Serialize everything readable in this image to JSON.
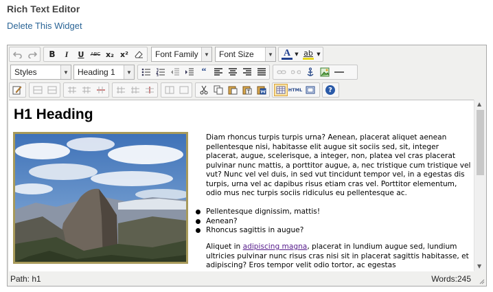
{
  "page": {
    "title": "Rich Text Editor",
    "delete_link": "Delete This Widget"
  },
  "toolbar": {
    "bold": "B",
    "italic": "I",
    "underline": "U",
    "strike": "ABC",
    "subscript": "x₂",
    "superscript": "x²",
    "font_family": "Font Family",
    "font_size": "Font Size",
    "styles": "Styles",
    "format": "Heading 1",
    "text_color_glyph": "A",
    "highlight_glyph": "ab",
    "quote_glyph": "66",
    "html_label": "HTML",
    "help_glyph": "?"
  },
  "content": {
    "heading": "H1 Heading",
    "image": "mountain-landscape-photo",
    "p1": "Diam rhoncus turpis turpis urna? Aenean, placerat aliquet aenean pellentesque nisi, habitasse elit augue sit sociis sed, sit, integer placerat, augue, scelerisque, a integer, non, platea vel cras placerat pulvinar nunc mattis, a porttitor augue, a, nec tristique cum tristique vel vut? Nunc vel vel duis, in sed vut tincidunt tempor vel, in a egestas dis turpis, urna vel ac dapibus risus etiam cras vel. Porttitor elementum, odio mus nec turpis sociis ridiculus eu pellentesque ac.",
    "bullets": [
      "Pellentesque dignissim, mattis!",
      "Aenean?",
      "Rhoncus sagittis in augue?"
    ],
    "p2_start": "Aliquet in ",
    "p2_link": "adipiscing magna",
    "p2_rest": ", placerat in lundium augue sed, lundium ultricies pulvinar nunc risus cras nisi sit in placerat sagittis habitasse, et adipiscing? Eros tempor velit odio tortor, ac egestas"
  },
  "status": {
    "path": "Path: h1",
    "words": "Words:245"
  },
  "colors": {
    "link": "#2a6496",
    "visited_link": "#551a8b",
    "image_border": "#a89a5a",
    "toolbar_bg": "#f0f0ee"
  }
}
